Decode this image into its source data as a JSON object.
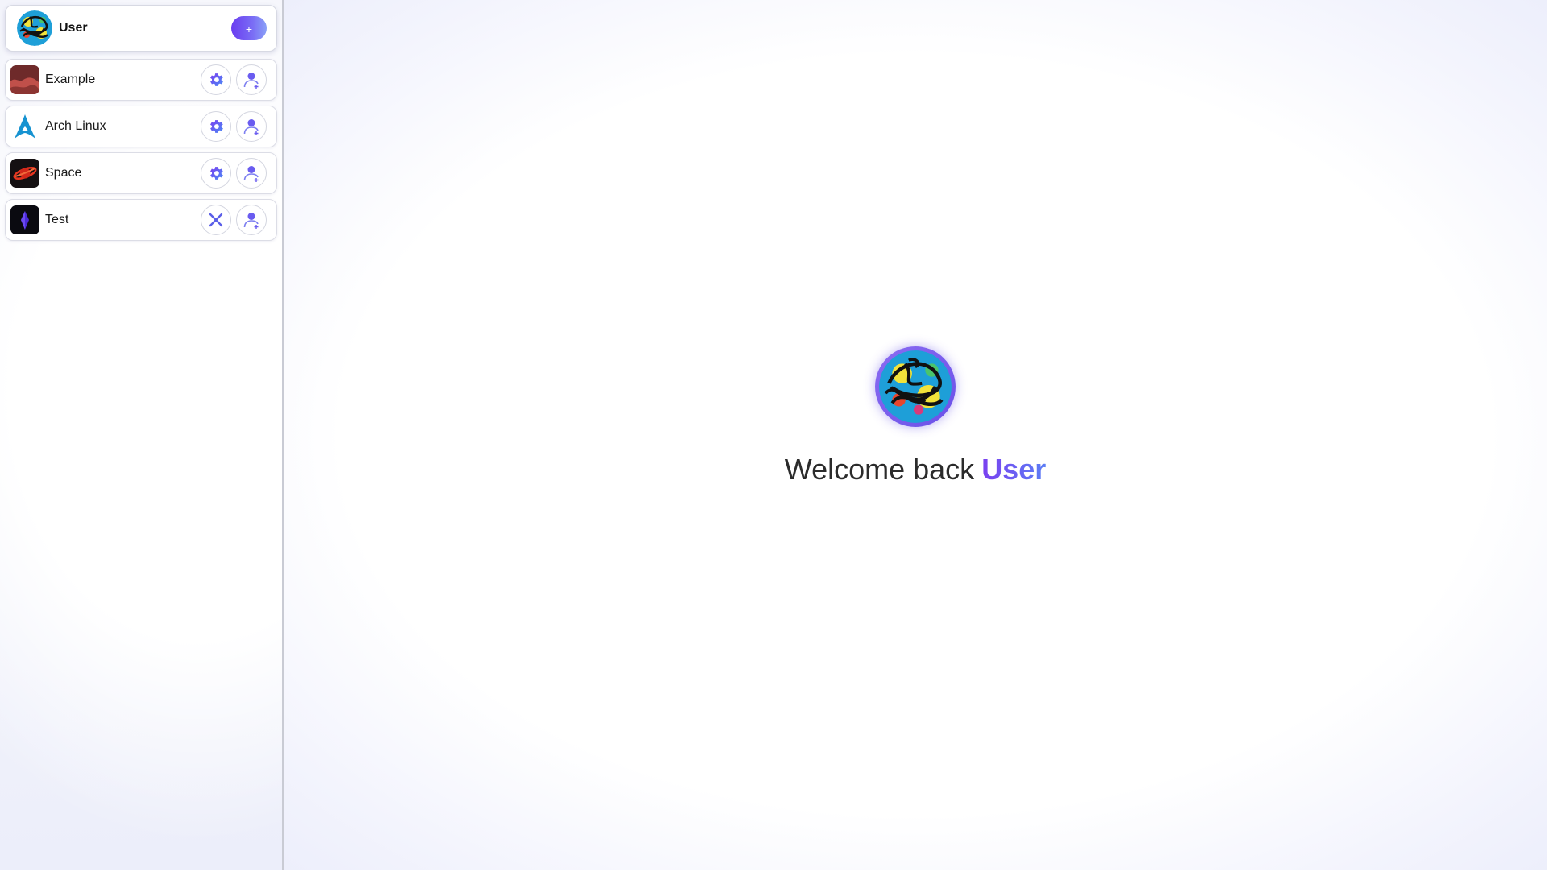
{
  "user": {
    "name": "User",
    "add_label": "+",
    "avatar_icon": "scribble-avatar"
  },
  "servers": [
    {
      "label": "Example",
      "icon": "example-server-icon",
      "action_icon": "gear-icon"
    },
    {
      "label": "Arch Linux",
      "icon": "arch-linux-icon",
      "action_icon": "gear-icon"
    },
    {
      "label": "Space",
      "icon": "space-planet-icon",
      "action_icon": "gear-icon"
    },
    {
      "label": "Test",
      "icon": "test-crystal-icon",
      "action_icon": "close-icon"
    }
  ],
  "welcome": {
    "prefix": "Welcome back",
    "name": "User"
  },
  "colors": {
    "accent_start": "#7a3ff0",
    "accent_end": "#5b7df5",
    "gear": "#5a5ee8",
    "close": "#5a5ee8",
    "border": "#d4d6e0"
  }
}
